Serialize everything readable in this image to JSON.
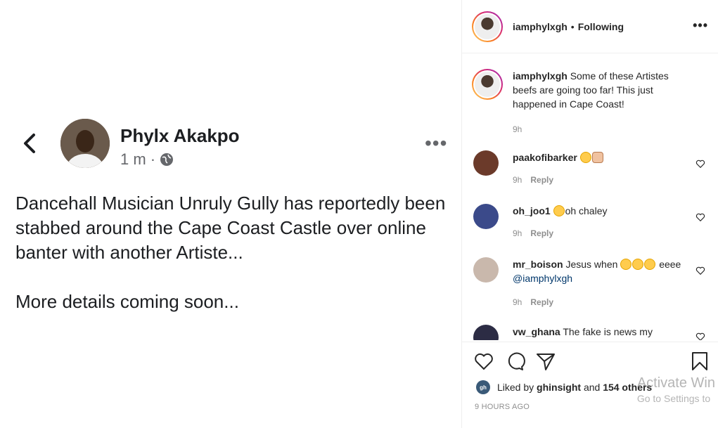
{
  "post_image": {
    "author": "Phylx Akakpo",
    "time": "1 m",
    "separator": "·",
    "paragraphs": [
      "Dancehall Musician Unruly Gully has reportedly been stabbed around the Cape Coast Castle over online banter with another Artiste...",
      "More details coming soon..."
    ]
  },
  "header": {
    "username": "iamphylxgh",
    "dot": "•",
    "follow_status": "Following"
  },
  "caption": {
    "username": "iamphylxgh",
    "text": "Some of these Artistes beefs are going too far! This just happened in Cape Coast!",
    "time": "9h"
  },
  "comments": [
    {
      "username": "paakofibarker",
      "text": "",
      "emojis": 2,
      "time": "9h",
      "reply": "Reply",
      "avatar_color": "#6b3a2a"
    },
    {
      "username": "oh_joo1",
      "text": "oh chaley",
      "emojis": 1,
      "time": "9h",
      "reply": "Reply",
      "avatar_color": "#3b4a8a"
    },
    {
      "username": "mr_boison",
      "text": "Jesus when",
      "emojis_after": 3,
      "text2": "eeee",
      "mention": "@iamphylxgh",
      "time": "9h",
      "reply": "Reply",
      "avatar_color": "#c9b8ac"
    },
    {
      "username": "vw_ghana",
      "text": "The fake is news my",
      "avatar_color": "#2c2c44"
    }
  ],
  "likes": {
    "prefix": "Liked by",
    "user": "ghinsight",
    "conj": "and",
    "others": "154 others",
    "avatar_text": "gh"
  },
  "timestamp": "9 HOURS AGO",
  "watermark": {
    "line1": "Activate Win",
    "line2": "Go to Settings to"
  }
}
